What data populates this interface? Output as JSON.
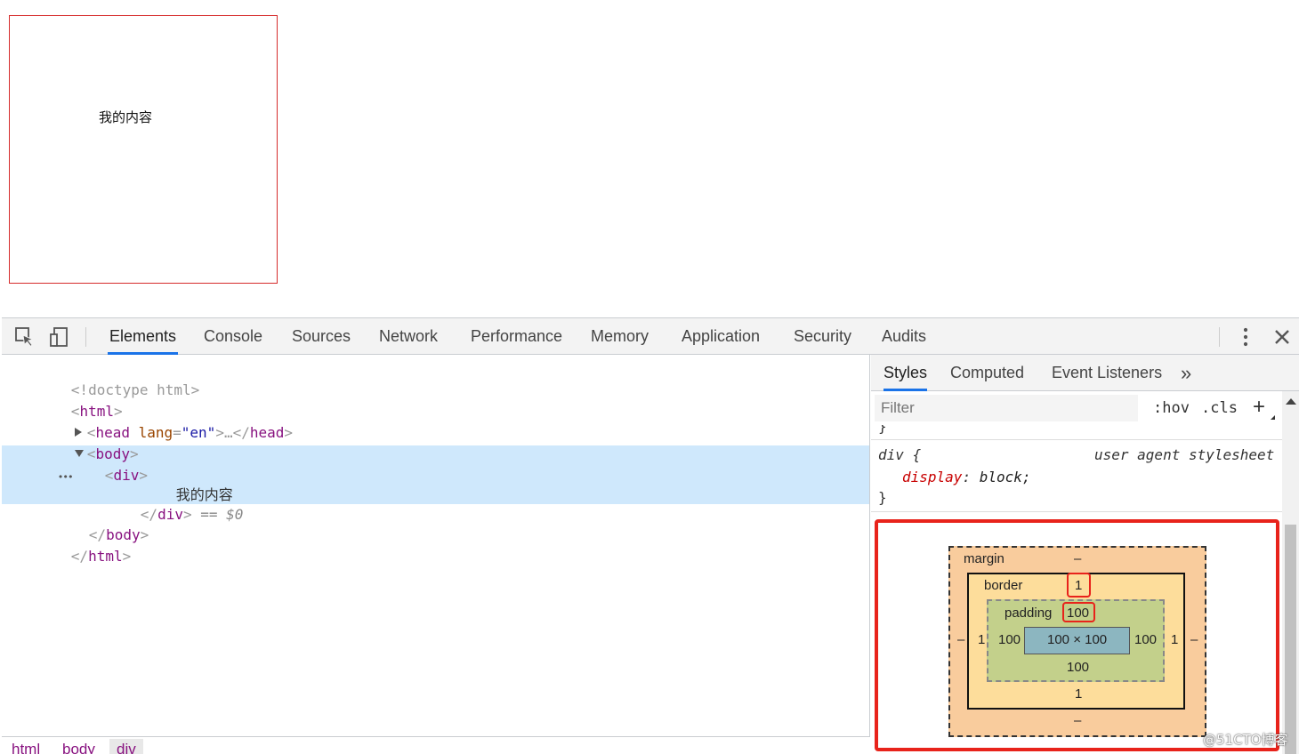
{
  "page": {
    "content_text": "我的内容",
    "box_color": "#d62c2c"
  },
  "devtools": {
    "toolbar": {
      "inspect_icon": "element-picker-icon",
      "device_icon": "device-toolbar-icon",
      "tabs": [
        {
          "label": "Elements",
          "active": true
        },
        {
          "label": "Console"
        },
        {
          "label": "Sources"
        },
        {
          "label": "Network"
        },
        {
          "label": "Performance"
        },
        {
          "label": "Memory"
        },
        {
          "label": "Application"
        },
        {
          "label": "Security"
        },
        {
          "label": "Audits"
        }
      ],
      "more_icon": "kebab-menu-icon",
      "close_icon": "close-icon",
      "accent_color": "#1a73e8"
    },
    "dom_tree": {
      "doctype": "<!doctype html>",
      "html_open": "html",
      "head_tag": "head",
      "head_attr_name": "lang",
      "head_attr_value": "\"en\"",
      "head_ellipsis": "…",
      "body_tag": "body",
      "div_tag": "div",
      "div_text": "我的内容",
      "selected_marker": "== $0",
      "row_dots": "•••",
      "body_close": "body",
      "html_close": "html"
    },
    "breadcrumbs": [
      "html",
      "body",
      "div"
    ],
    "sidebar": {
      "tabs": [
        {
          "label": "Styles",
          "active": true
        },
        {
          "label": "Computed"
        },
        {
          "label": "Event Listeners"
        }
      ],
      "overflow": "»",
      "filter_placeholder": "Filter",
      "hov_label": ":hov",
      "cls_label": ".cls",
      "add_label": "+",
      "rule": {
        "prev_brace": "}",
        "selector": "div {",
        "source": "user agent stylesheet",
        "property": "display",
        "value": "block;",
        "close_brace": "}"
      }
    },
    "box_model": {
      "margin_label": "margin",
      "margin_top": "–",
      "margin_bottom": "–",
      "margin_left": "–",
      "margin_right": "–",
      "border_label": "border",
      "border_top": "1",
      "border_bottom": "1",
      "border_left": "1",
      "border_right": "1",
      "padding_label": "padding",
      "padding_top": "100",
      "padding_bottom": "100",
      "padding_left": "100",
      "padding_right": "100",
      "content": "100 × 100",
      "margin_color": "#f9cc9d",
      "border_color": "#fddd9b",
      "padding_color": "#c3d08b",
      "content_color": "#8cb6c0",
      "highlight_color": "#e8231b"
    }
  },
  "watermark": "@51CTO博客"
}
